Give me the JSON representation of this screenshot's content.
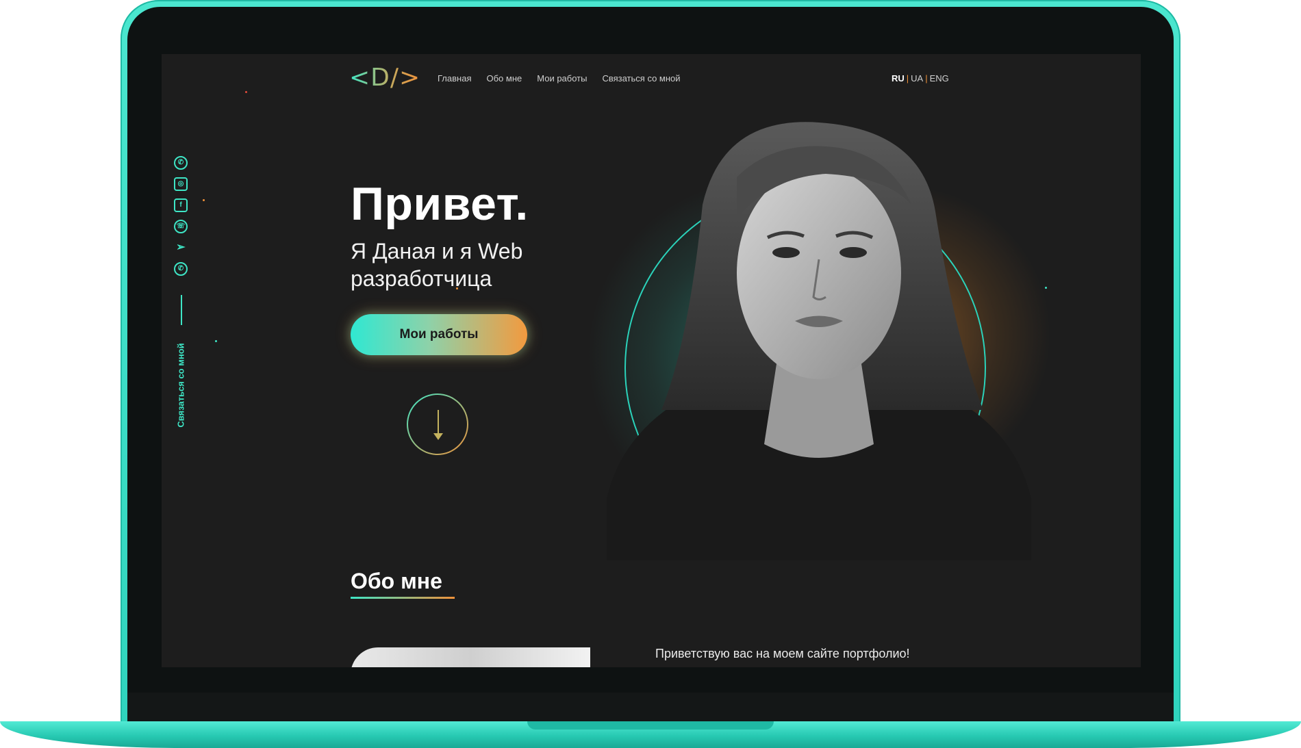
{
  "logo": "<D/>",
  "nav": {
    "items": [
      "Главная",
      "Обо мне",
      "Мои работы",
      "Связаться со мной"
    ]
  },
  "lang": {
    "ru": "RU",
    "ua": "UA",
    "eng": "ENG",
    "separator": "|"
  },
  "social": {
    "icons": [
      "whatsapp-icon",
      "instagram-icon",
      "facebook-icon",
      "phone-icon",
      "telegram-icon",
      "viber-icon"
    ],
    "contact_label": "Связаться со мной"
  },
  "hero": {
    "title": "Привет.",
    "subtitle": "Я Даная и я Web разработчица",
    "cta_label": "Мои работы"
  },
  "about": {
    "title": "Обо мне",
    "greeting": "Приветствую вас на моем сайте портфолио!"
  },
  "colors": {
    "accent_teal": "#3ee6c6",
    "accent_orange": "#f0913a",
    "background": "#1d1d1d",
    "laptop_body": "#2fd4bd"
  }
}
